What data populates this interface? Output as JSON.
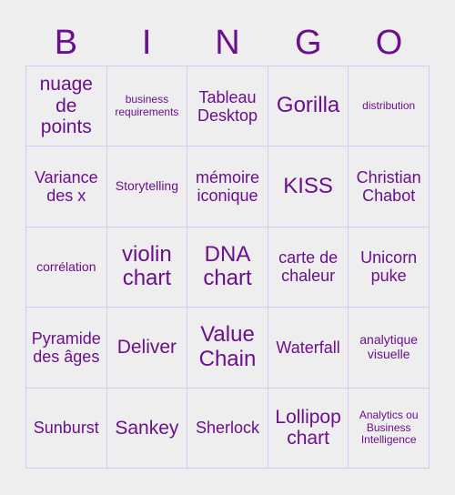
{
  "card": {
    "title_letters": [
      "B",
      "I",
      "N",
      "G",
      "O"
    ],
    "accent_color": "#6b0f8f",
    "background_color": "#efeeee",
    "grid_line_color": "#d9c9f2",
    "rows": [
      [
        {
          "text": "nuage de points",
          "size": "sz-lg"
        },
        {
          "text": "business requirements",
          "size": "sz-xs"
        },
        {
          "text": "Tableau Desktop",
          "size": "sz-md"
        },
        {
          "text": "Gorilla",
          "size": "sz-xl"
        },
        {
          "text": "distribution",
          "size": "sz-xs"
        }
      ],
      [
        {
          "text": "Variance des x",
          "size": "sz-md"
        },
        {
          "text": "Storytelling",
          "size": "sz-sm"
        },
        {
          "text": "mémoire iconique",
          "size": "sz-md"
        },
        {
          "text": "KISS",
          "size": "sz-xl"
        },
        {
          "text": "Christian Chabot",
          "size": "sz-md"
        }
      ],
      [
        {
          "text": "corrélation",
          "size": "sz-sm"
        },
        {
          "text": "violin chart",
          "size": "sz-xl"
        },
        {
          "text": "DNA chart",
          "size": "sz-xl"
        },
        {
          "text": "carte de chaleur",
          "size": "sz-md"
        },
        {
          "text": "Unicorn puke",
          "size": "sz-md"
        }
      ],
      [
        {
          "text": "Pyramide des âges",
          "size": "sz-md"
        },
        {
          "text": "Deliver",
          "size": "sz-lg"
        },
        {
          "text": "Value Chain",
          "size": "sz-xl"
        },
        {
          "text": "Waterfall",
          "size": "sz-md"
        },
        {
          "text": "analytique visuelle",
          "size": "sz-sm"
        }
      ],
      [
        {
          "text": "Sunburst",
          "size": "sz-md"
        },
        {
          "text": "Sankey",
          "size": "sz-lg"
        },
        {
          "text": "Sherlock",
          "size": "sz-md"
        },
        {
          "text": "Lollipop chart",
          "size": "sz-lg"
        },
        {
          "text": "Analytics ou Business Intelligence",
          "size": "sz-xs"
        }
      ]
    ]
  }
}
